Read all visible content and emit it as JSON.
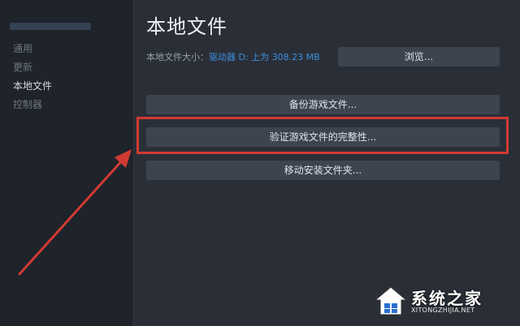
{
  "sidebar": {
    "items": [
      {
        "label": "通用"
      },
      {
        "label": "更新"
      },
      {
        "label": "本地文件"
      },
      {
        "label": "控制器"
      }
    ]
  },
  "main": {
    "title": "本地文件",
    "size_label": "本地文件大小：",
    "size_drive": "驱动器 D: ",
    "size_value": "上为 308.23 MB",
    "browse_label": "浏览...",
    "backup_label": "备份游戏文件...",
    "verify_label": "验证游戏文件的完整性...",
    "move_label": "移动安装文件夹..."
  },
  "watermark": {
    "text": "系统之家",
    "url": "XITONGZHIJIA.NET"
  },
  "colors": {
    "highlight": "#d23a34",
    "link": "#3d8fe0",
    "background": "#2a2f37",
    "button": "#3d4450"
  }
}
